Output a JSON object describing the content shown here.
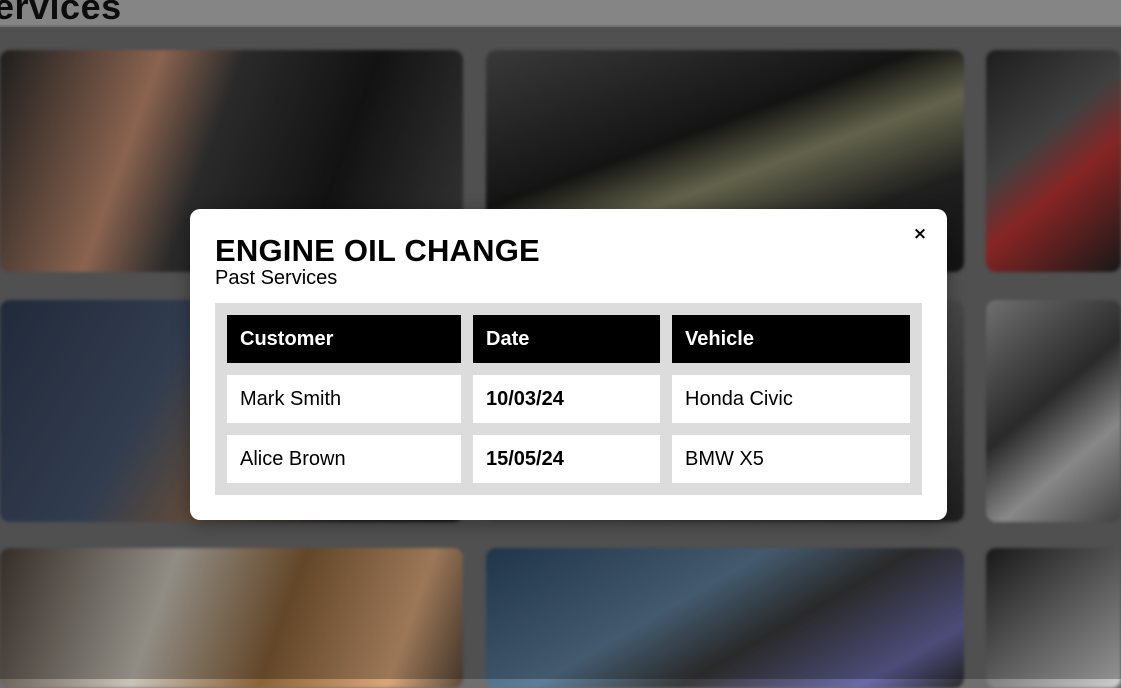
{
  "page": {
    "title": "ervices"
  },
  "modal": {
    "title": "ENGINE OIL CHANGE",
    "subtitle": "Past Services",
    "close_label": "×",
    "table": {
      "headers": [
        "Customer",
        "Date",
        "Vehicle"
      ],
      "rows": [
        [
          "Mark Smith",
          "10/03/24",
          "Honda Civic"
        ],
        [
          "Alice Brown",
          "15/05/24",
          "BMW X5"
        ]
      ]
    }
  },
  "colors": {
    "header_bg": "#000000",
    "table_bg": "#dcdcdc",
    "overlay": "rgba(0,0,0,0.28)"
  }
}
